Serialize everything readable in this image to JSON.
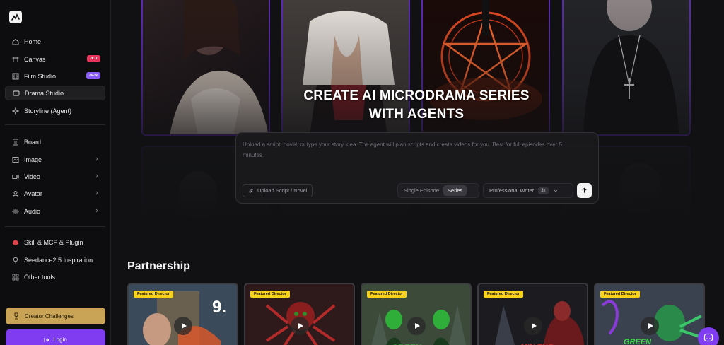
{
  "sidebar": {
    "logo_icon": "logo-icon",
    "groups": [
      [
        {
          "label": "Home",
          "icon": "home-icon"
        },
        {
          "label": "Canvas",
          "icon": "canvas-icon",
          "badge": "HOT"
        },
        {
          "label": "Film Studio",
          "icon": "film-icon",
          "badge": "NEW"
        },
        {
          "label": "Drama Studio",
          "icon": "drama-icon",
          "active": true
        },
        {
          "label": "Storyline (Agent)",
          "icon": "storyline-icon"
        }
      ],
      [
        {
          "label": "Board",
          "icon": "board-icon"
        },
        {
          "label": "Image",
          "icon": "image-icon",
          "chevron": true
        },
        {
          "label": "Video",
          "icon": "video-icon",
          "chevron": true
        },
        {
          "label": "Avatar",
          "icon": "avatar-icon",
          "chevron": true
        },
        {
          "label": "Audio",
          "icon": "audio-icon",
          "chevron": true
        }
      ],
      [
        {
          "label": "Skill & MCP & Plugin",
          "icon": "plugin-icon"
        },
        {
          "label": "Seedance2.5 Inspiration",
          "icon": "bulb-icon"
        },
        {
          "label": "Other tools",
          "icon": "tools-icon"
        }
      ]
    ],
    "creator_challenges": "Creator Challenges",
    "login": "Login"
  },
  "hero": {
    "title_line1": "CREATE AI MICRODRAMA SERIES",
    "title_line2": "WITH AGENTS"
  },
  "prompt": {
    "placeholder": "Upload a script, novel, or type your story idea. The agent will plan scripts and create videos for you. Best for full episodes over 5 minutes.",
    "upload_label": "Upload Script / Novel",
    "modes": [
      "Single Episode",
      "Series"
    ],
    "selected_mode": "Series",
    "writer_label": "Professional Writer",
    "writer_multiplier": "3x"
  },
  "partnership": {
    "title": "Partnership",
    "cards": [
      {
        "tag": "Featured Director"
      },
      {
        "tag": "Featured Director"
      },
      {
        "tag": "Featured Director"
      },
      {
        "tag": "Featured Director"
      },
      {
        "tag": "Featured Director"
      }
    ]
  },
  "colors": {
    "accent": "#7f3cf0",
    "gold": "#c9a457",
    "hot_badge": "#e8335b",
    "new_badge": "#8a5cf6",
    "featured_tag": "#f6d21c"
  }
}
